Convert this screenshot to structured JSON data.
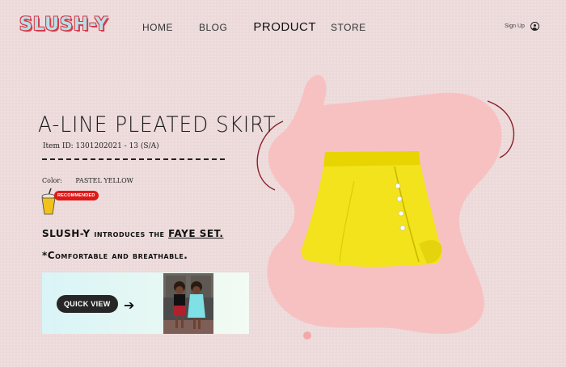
{
  "header": {
    "logo_text": "SLUSH-Y",
    "nav": [
      {
        "label": "HOME"
      },
      {
        "label": "BLOG"
      },
      {
        "label": "PRODUCT"
      },
      {
        "label": "STORE"
      }
    ],
    "signup_label": "Sign Up"
  },
  "product": {
    "title": "A-LINE PLEATED SKIRT",
    "item_id": "Item ID: 1301202021 - 13 (S/A)",
    "color_label": "Color:",
    "color_value": "PASTEL YELLOW",
    "badge": "RECOMMENDED",
    "intro_prefix": "SLUSH-Y introduces the ",
    "intro_link": "FAYE SET.",
    "tagline": "*Comfortable and breathable."
  },
  "promo": {
    "quick_view_label": "QUICK VIEW",
    "arrow": "➔"
  },
  "colors": {
    "accent_pink": "#f8c1c1",
    "skirt_yellow": "#f2e31c",
    "badge_red": "#e01818",
    "promo_teal": "#d9f4f7"
  }
}
